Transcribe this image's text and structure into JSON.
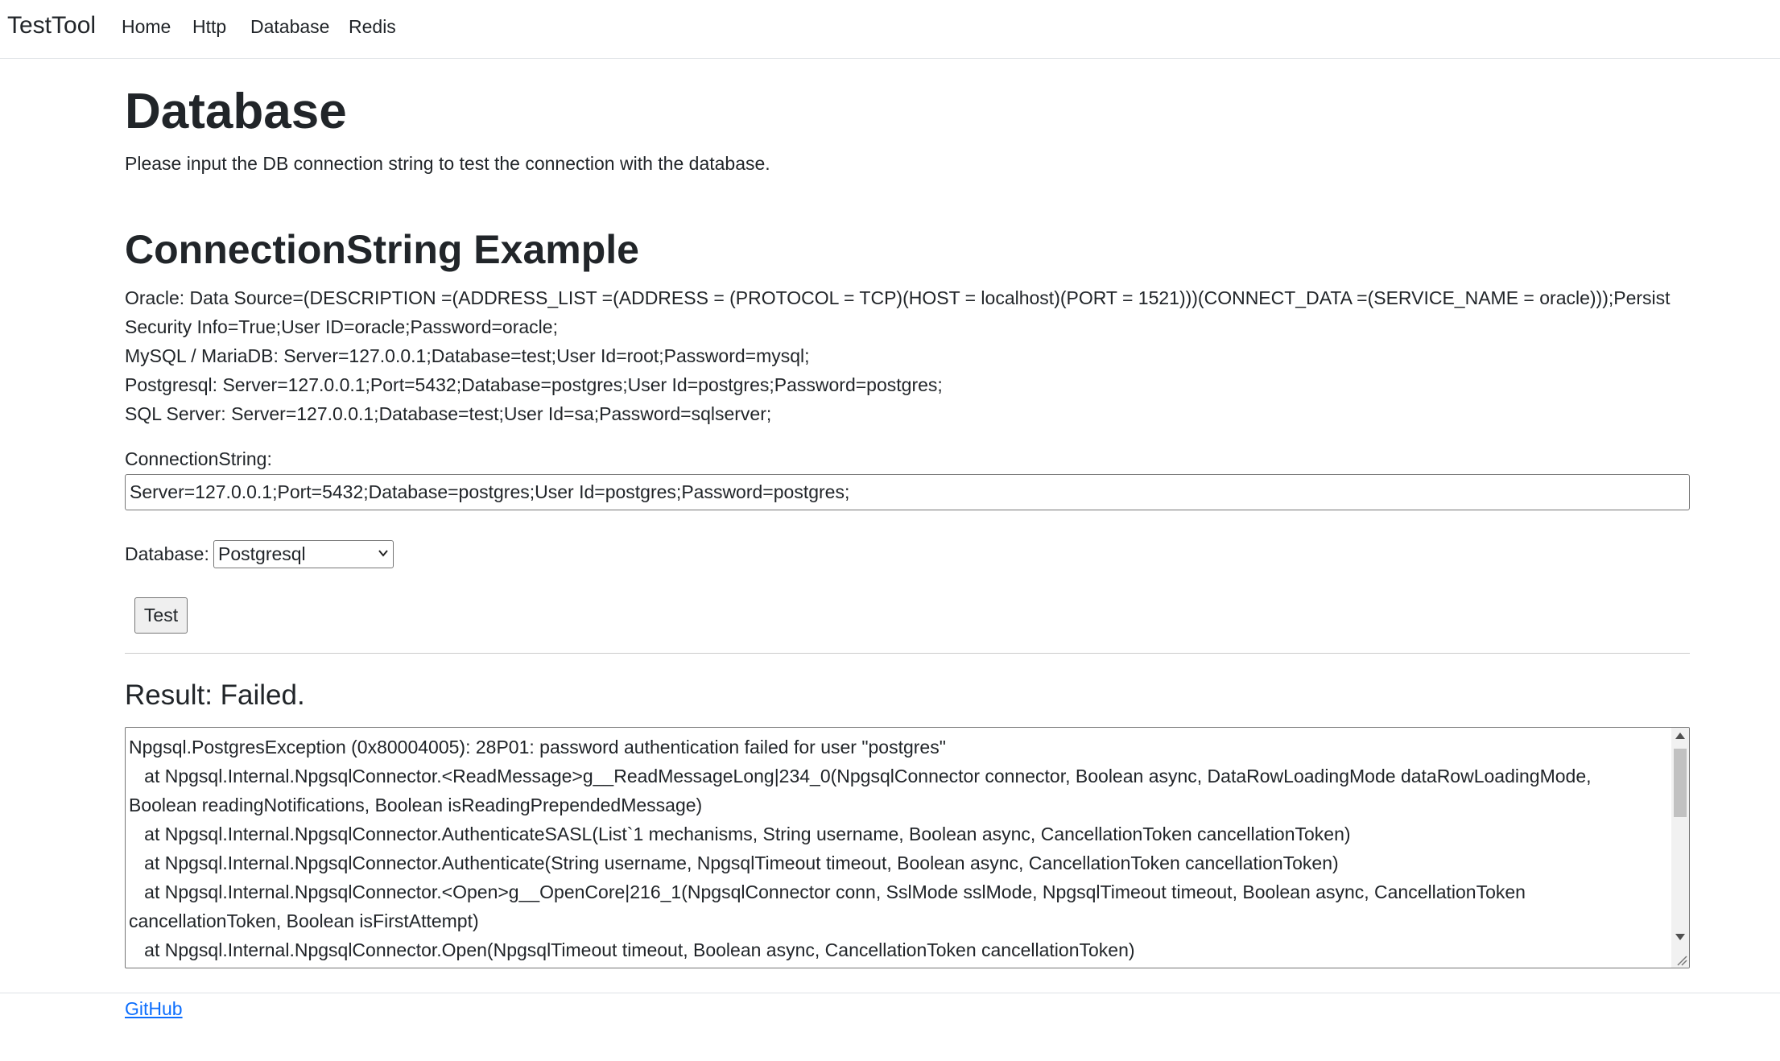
{
  "nav": {
    "brand": "TestTool",
    "links": [
      "Home",
      "Http",
      "Database",
      "Redis"
    ]
  },
  "page": {
    "title": "Database",
    "lead": "Please input the DB connection string to test the connection with the database."
  },
  "examples": {
    "title": "ConnectionString Example",
    "lines": [
      "Oracle: Data Source=(DESCRIPTION =(ADDRESS_LIST =(ADDRESS = (PROTOCOL = TCP)(HOST = localhost)(PORT = 1521)))(CONNECT_DATA =(SERVICE_NAME = oracle)));Persist Security Info=True;User ID=oracle;Password=oracle;",
      "MySQL / MariaDB: Server=127.0.0.1;Database=test;User Id=root;Password=mysql;",
      "Postgresql: Server=127.0.0.1;Port=5432;Database=postgres;User Id=postgres;Password=postgres;",
      "SQL Server: Server=127.0.0.1;Database=test;User Id=sa;Password=sqlserver;"
    ]
  },
  "form": {
    "conn_label": "ConnectionString:",
    "conn_value": "Server=127.0.0.1;Port=5432;Database=postgres;User Id=postgres;Password=postgres;",
    "db_label": "Database:",
    "db_selected": "Postgresql",
    "test_label": "Test"
  },
  "result": {
    "title": "Result: Failed.",
    "lines": [
      "Npgsql.PostgresException (0x80004005): 28P01: password authentication failed for user \"postgres\"",
      "   at Npgsql.Internal.NpgsqlConnector.<ReadMessage>g__ReadMessageLong|234_0(NpgsqlConnector connector, Boolean async, DataRowLoadingMode dataRowLoadingMode, Boolean readingNotifications, Boolean isReadingPrependedMessage)",
      "   at Npgsql.Internal.NpgsqlConnector.AuthenticateSASL(List`1 mechanisms, String username, Boolean async, CancellationToken cancellationToken)",
      "   at Npgsql.Internal.NpgsqlConnector.Authenticate(String username, NpgsqlTimeout timeout, Boolean async, CancellationToken cancellationToken)",
      "   at Npgsql.Internal.NpgsqlConnector.<Open>g__OpenCore|216_1(NpgsqlConnector conn, SslMode sslMode, NpgsqlTimeout timeout, Boolean async, CancellationToken cancellationToken, Boolean isFirstAttempt)",
      "   at Npgsql.Internal.NpgsqlConnector.Open(NpgsqlTimeout timeout, Boolean async, CancellationToken cancellationToken)"
    ]
  },
  "footer": {
    "link": "GitHub"
  }
}
